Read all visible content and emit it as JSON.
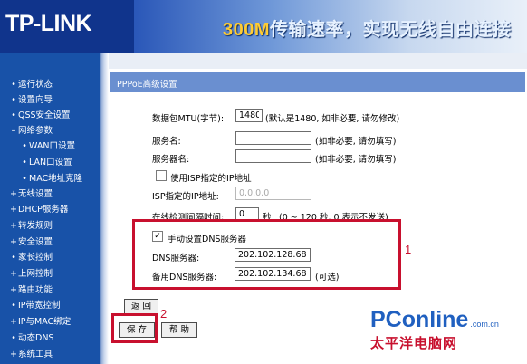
{
  "header": {
    "logo": "TP-LINK",
    "slogan_num": "300M",
    "slogan_text": "传输速率，实现无线自由连接"
  },
  "sidebar": {
    "items": [
      {
        "label": "运行状态",
        "bullet": "•"
      },
      {
        "label": "设置向导",
        "bullet": "•"
      },
      {
        "label": "QSS安全设置",
        "bullet": "•"
      },
      {
        "label": "网络参数",
        "bullet": "–"
      },
      {
        "label": "WAN口设置",
        "bullet": "•"
      },
      {
        "label": "LAN口设置",
        "bullet": "•"
      },
      {
        "label": "MAC地址克隆",
        "bullet": "•"
      },
      {
        "label": "无线设置",
        "bullet": "+"
      },
      {
        "label": "DHCP服务器",
        "bullet": "+"
      },
      {
        "label": "转发规则",
        "bullet": "+"
      },
      {
        "label": "安全设置",
        "bullet": "+"
      },
      {
        "label": "家长控制",
        "bullet": "•"
      },
      {
        "label": "上网控制",
        "bullet": "+"
      },
      {
        "label": "路由功能",
        "bullet": "+"
      },
      {
        "label": "IP带宽控制",
        "bullet": "•"
      },
      {
        "label": "IP与MAC绑定",
        "bullet": "+"
      },
      {
        "label": "动态DNS",
        "bullet": "•"
      },
      {
        "label": "系统工具",
        "bullet": "+"
      }
    ]
  },
  "panel": {
    "title": "PPPoE高级设置",
    "mtu_label": "数据包MTU(字节):",
    "mtu_value": "1480",
    "mtu_hint": "(默认是1480, 如非必要, 请勿修改)",
    "service_label": "服务名:",
    "service_value": "",
    "service_hint": "(如非必要, 请勿填写)",
    "server_label": "服务器名:",
    "server_value": "",
    "server_hint": "(如非必要, 请勿填写)",
    "isp_ip_check_label": "使用ISP指定的IP地址",
    "isp_ip_check_mark": "",
    "isp_ip_label": "ISP指定的IP地址:",
    "isp_ip_value": "0.0.0.0",
    "idle_label": "在线检测间隔时间:",
    "idle_value": "0",
    "idle_unit": "秒",
    "idle_hint": "(0 ~ 120 秒, 0 表示不发送)",
    "dns_check_label": "手动设置DNS服务器",
    "dns_check_mark": "✓",
    "dns_label": "DNS服务器:",
    "dns_value": "202.102.128.68",
    "dns2_label": "备用DNS服务器:",
    "dns2_value": "202.102.134.68",
    "dns2_hint": "(可选)"
  },
  "buttons": {
    "back": "返 回",
    "save": "保 存",
    "help": "帮 助"
  },
  "annotations": {
    "one": "1",
    "two": "2"
  },
  "watermark": {
    "main": "PConline",
    "domain": ".com.cn",
    "sub": "太平洋电脑网"
  },
  "colors": {
    "header_bg": "#10348c",
    "sidebar_bg": "#1852a8",
    "panel_title_bg": "#6a8fd0",
    "annotation_red": "#c8102e"
  }
}
